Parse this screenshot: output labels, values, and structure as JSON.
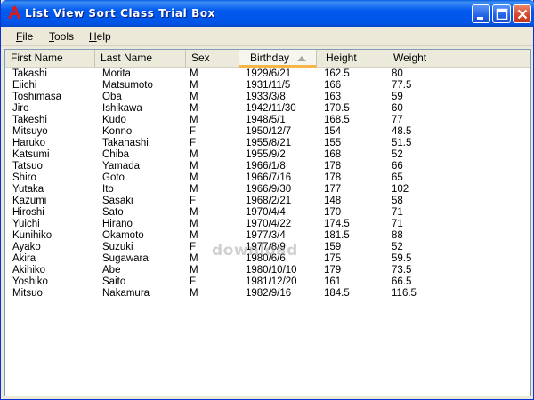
{
  "window": {
    "title": "List View Sort Class Trial Box",
    "app_icon": "red-letter-a-icon"
  },
  "titlebar_buttons": [
    "minimize-icon",
    "maximize-icon",
    "close-icon"
  ],
  "menu": {
    "file": {
      "pre": "",
      "u": "F",
      "post": "ile"
    },
    "tools": {
      "pre": "",
      "u": "T",
      "post": "ools"
    },
    "help": {
      "pre": "",
      "u": "H",
      "post": "elp"
    }
  },
  "table": {
    "columns": [
      "First Name",
      "Last Name",
      "Sex",
      "Birthday",
      "Height",
      "Weight"
    ],
    "sorted_column": "Birthday",
    "sort_direction": "ascending",
    "rows": [
      [
        "Takashi",
        "Morita",
        "M",
        "1929/6/21",
        "162.5",
        "80"
      ],
      [
        "Eiichi",
        "Matsumoto",
        "M",
        "1931/11/5",
        "166",
        "77.5"
      ],
      [
        "Toshimasa",
        "Oba",
        "M",
        "1933/3/8",
        "163",
        "59"
      ],
      [
        "Jiro",
        "Ishikawa",
        "M",
        "1942/11/30",
        "170.5",
        "60"
      ],
      [
        "Takeshi",
        "Kudo",
        "M",
        "1948/5/1",
        "168.5",
        "77"
      ],
      [
        "Mitsuyo",
        "Konno",
        "F",
        "1950/12/7",
        "154",
        "48.5"
      ],
      [
        "Haruko",
        "Takahashi",
        "F",
        "1955/8/21",
        "155",
        "51.5"
      ],
      [
        "Katsumi",
        "Chiba",
        "M",
        "1955/9/2",
        "168",
        "52"
      ],
      [
        "Tatsuo",
        "Yamada",
        "M",
        "1966/1/8",
        "178",
        "66"
      ],
      [
        "Shiro",
        "Goto",
        "M",
        "1966/7/16",
        "178",
        "65"
      ],
      [
        "Yutaka",
        "Ito",
        "M",
        "1966/9/30",
        "177",
        "102"
      ],
      [
        "Kazumi",
        "Sasaki",
        "F",
        "1968/2/21",
        "148",
        "58"
      ],
      [
        "Hiroshi",
        "Sato",
        "M",
        "1970/4/4",
        "170",
        "71"
      ],
      [
        "Yuichi",
        "Hirano",
        "M",
        "1970/4/22",
        "174.5",
        "71"
      ],
      [
        "Kunihiko",
        "Okamoto",
        "M",
        "1977/3/4",
        "181.5",
        "88"
      ],
      [
        "Ayako",
        "Suzuki",
        "F",
        "1977/8/9",
        "159",
        "52"
      ],
      [
        "Akira",
        "Sugawara",
        "M",
        "1980/6/6",
        "175",
        "59.5"
      ],
      [
        "Akihiko",
        "Abe",
        "M",
        "1980/10/10",
        "179",
        "73.5"
      ],
      [
        "Yoshiko",
        "Saito",
        "F",
        "1981/12/20",
        "161",
        "66.5"
      ],
      [
        "Mitsuo",
        "Nakamura",
        "M",
        "1982/9/16",
        "184.5",
        "116.5"
      ]
    ]
  },
  "watermark": "download",
  "colors": {
    "titlebar": "#0055e5",
    "sort_highlight": "#f7b64a",
    "close_button": "#d6462a"
  }
}
